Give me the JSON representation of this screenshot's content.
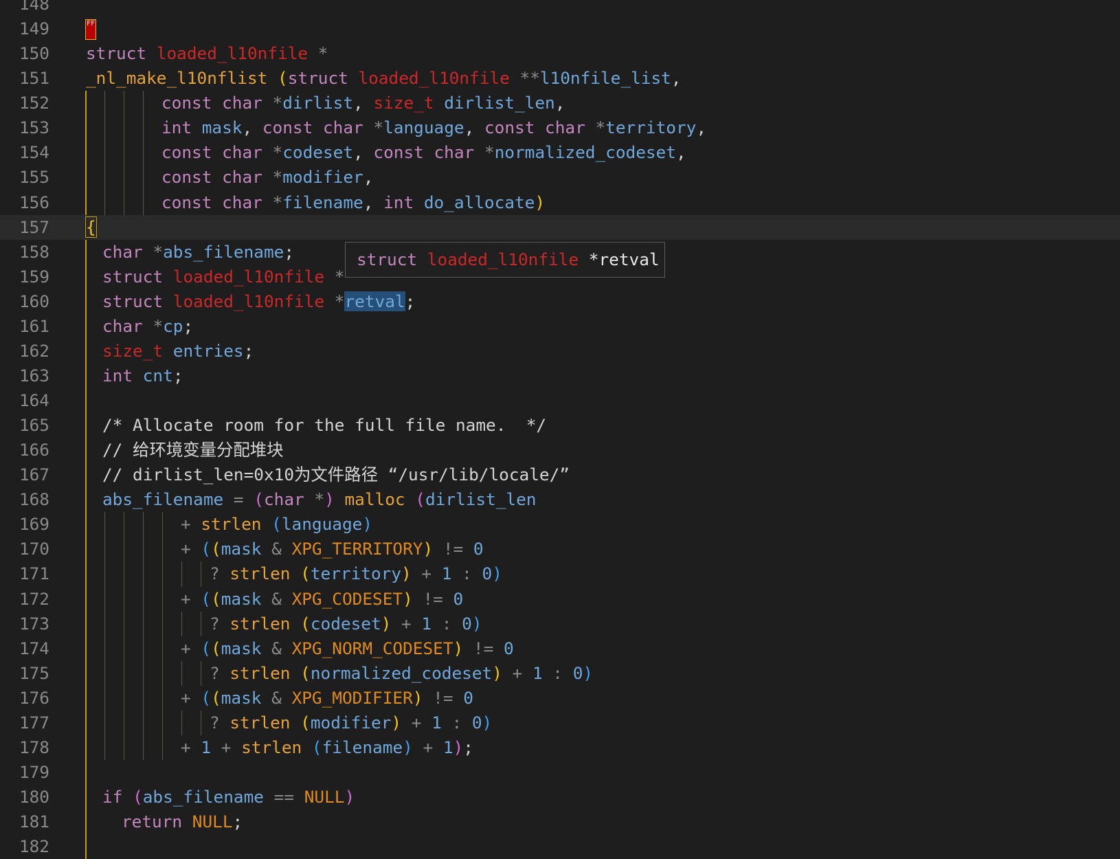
{
  "hover": {
    "kw": "struct",
    "type": "loaded_l10nfile",
    "rest": "*retval"
  },
  "lines": [
    {
      "n": "148",
      "tokens": []
    },
    {
      "n": "149",
      "tokens": [],
      "ff": "FF"
    },
    {
      "n": "150",
      "tokens": [
        {
          "t": "struct ",
          "c": "kw"
        },
        {
          "t": "loaded_l10nfile",
          "c": "ty"
        },
        {
          "t": " *",
          "c": "op"
        }
      ]
    },
    {
      "n": "151",
      "tokens": [
        {
          "t": "_nl_make_l10nflist",
          "c": "fn"
        },
        {
          "t": " ",
          "c": "pn"
        },
        {
          "t": "(",
          "c": "b1"
        },
        {
          "t": "struct ",
          "c": "kw"
        },
        {
          "t": "loaded_l10nfile",
          "c": "ty"
        },
        {
          "t": " **",
          "c": "op"
        },
        {
          "t": "l10nfile_list",
          "c": "va"
        },
        {
          "t": ",",
          "c": "pn"
        }
      ]
    },
    {
      "n": "152",
      "indent": 115,
      "tokens": [
        {
          "t": "const char ",
          "c": "kw"
        },
        {
          "t": "*",
          "c": "op"
        },
        {
          "t": "dirlist",
          "c": "va"
        },
        {
          "t": ", ",
          "c": "pn"
        },
        {
          "t": "size_t",
          "c": "ty"
        },
        {
          "t": " ",
          "c": "pn"
        },
        {
          "t": "dirlist_len",
          "c": "va"
        },
        {
          "t": ",",
          "c": "pn"
        }
      ]
    },
    {
      "n": "153",
      "indent": 115,
      "tokens": [
        {
          "t": "int ",
          "c": "kw"
        },
        {
          "t": "mask",
          "c": "va"
        },
        {
          "t": ", ",
          "c": "pn"
        },
        {
          "t": "const char ",
          "c": "kw"
        },
        {
          "t": "*",
          "c": "op"
        },
        {
          "t": "language",
          "c": "va"
        },
        {
          "t": ", ",
          "c": "pn"
        },
        {
          "t": "const char ",
          "c": "kw"
        },
        {
          "t": "*",
          "c": "op"
        },
        {
          "t": "territory",
          "c": "va"
        },
        {
          "t": ",",
          "c": "pn"
        }
      ]
    },
    {
      "n": "154",
      "indent": 115,
      "tokens": [
        {
          "t": "const char ",
          "c": "kw"
        },
        {
          "t": "*",
          "c": "op"
        },
        {
          "t": "codeset",
          "c": "va"
        },
        {
          "t": ", ",
          "c": "pn"
        },
        {
          "t": "const char ",
          "c": "kw"
        },
        {
          "t": "*",
          "c": "op"
        },
        {
          "t": "normalized_codeset",
          "c": "va"
        },
        {
          "t": ",",
          "c": "pn"
        }
      ]
    },
    {
      "n": "155",
      "indent": 115,
      "tokens": [
        {
          "t": "const char ",
          "c": "kw"
        },
        {
          "t": "*",
          "c": "op"
        },
        {
          "t": "modifier",
          "c": "va"
        },
        {
          "t": ",",
          "c": "pn"
        }
      ]
    },
    {
      "n": "156",
      "indent": 115,
      "tokens": [
        {
          "t": "const char ",
          "c": "kw"
        },
        {
          "t": "*",
          "c": "op"
        },
        {
          "t": "filename",
          "c": "va"
        },
        {
          "t": ", ",
          "c": "pn"
        },
        {
          "t": "int ",
          "c": "kw"
        },
        {
          "t": "do_allocate",
          "c": "va"
        },
        {
          "t": ")",
          "c": "b1"
        }
      ]
    },
    {
      "n": "157",
      "current": true,
      "tokens": [
        {
          "t": "{",
          "c": "b1 brace-hl"
        }
      ]
    },
    {
      "n": "158",
      "indent": 29,
      "tokens": [
        {
          "t": "char ",
          "c": "kw"
        },
        {
          "t": "*",
          "c": "op"
        },
        {
          "t": "abs_filename",
          "c": "va"
        },
        {
          "t": ";",
          "c": "pn"
        }
      ]
    },
    {
      "n": "159",
      "indent": 29,
      "tokens": [
        {
          "t": "struct ",
          "c": "kw"
        },
        {
          "t": "loaded_l10nfile",
          "c": "ty"
        },
        {
          "t": " *",
          "c": "op"
        }
      ]
    },
    {
      "n": "160",
      "indent": 29,
      "tokens": [
        {
          "t": "struct ",
          "c": "kw"
        },
        {
          "t": "loaded_l10nfile",
          "c": "ty"
        },
        {
          "t": " *",
          "c": "op"
        },
        {
          "t": "retval",
          "c": "va sel"
        },
        {
          "t": ";",
          "c": "pn"
        }
      ]
    },
    {
      "n": "161",
      "indent": 29,
      "tokens": [
        {
          "t": "char ",
          "c": "kw"
        },
        {
          "t": "*",
          "c": "op"
        },
        {
          "t": "cp",
          "c": "va"
        },
        {
          "t": ";",
          "c": "pn"
        }
      ]
    },
    {
      "n": "162",
      "indent": 29,
      "tokens": [
        {
          "t": "size_t",
          "c": "ty"
        },
        {
          "t": " ",
          "c": "pn"
        },
        {
          "t": "entries",
          "c": "va"
        },
        {
          "t": ";",
          "c": "pn"
        }
      ]
    },
    {
      "n": "163",
      "indent": 29,
      "tokens": [
        {
          "t": "int ",
          "c": "kw"
        },
        {
          "t": "cnt",
          "c": "va"
        },
        {
          "t": ";",
          "c": "pn"
        }
      ]
    },
    {
      "n": "164",
      "tokens": []
    },
    {
      "n": "165",
      "indent": 29,
      "tokens": [
        {
          "t": "/* Allocate room for the full file name.  */",
          "c": "cm"
        }
      ]
    },
    {
      "n": "166",
      "indent": 29,
      "tokens": [
        {
          "t": "// 给环境变量分配堆块",
          "c": "cm"
        }
      ]
    },
    {
      "n": "167",
      "indent": 29,
      "tokens": [
        {
          "t": "// dirlist_len=0x10为文件路径 “/usr/lib/locale/”",
          "c": "cm"
        }
      ]
    },
    {
      "n": "168",
      "indent": 29,
      "tokens": [
        {
          "t": "abs_filename",
          "c": "va"
        },
        {
          "t": " = ",
          "c": "op"
        },
        {
          "t": "(",
          "c": "b2"
        },
        {
          "t": "char ",
          "c": "kw"
        },
        {
          "t": "*",
          "c": "op"
        },
        {
          "t": ")",
          "c": "b2"
        },
        {
          "t": " ",
          "c": "pn"
        },
        {
          "t": "malloc",
          "c": "fn"
        },
        {
          "t": " ",
          "c": "pn"
        },
        {
          "t": "(",
          "c": "b2"
        },
        {
          "t": "dirlist_len",
          "c": "va"
        }
      ]
    },
    {
      "n": "169",
      "indent": 143,
      "tokens": [
        {
          "t": "+ ",
          "c": "op"
        },
        {
          "t": "strlen",
          "c": "fn"
        },
        {
          "t": " ",
          "c": "pn"
        },
        {
          "t": "(",
          "c": "b3"
        },
        {
          "t": "language",
          "c": "va"
        },
        {
          "t": ")",
          "c": "b3"
        }
      ]
    },
    {
      "n": "170",
      "indent": 143,
      "tokens": [
        {
          "t": "+ ",
          "c": "op"
        },
        {
          "t": "(",
          "c": "b3"
        },
        {
          "t": "(",
          "c": "b1"
        },
        {
          "t": "mask",
          "c": "va"
        },
        {
          "t": " & ",
          "c": "op"
        },
        {
          "t": "XPG_TERRITORY",
          "c": "mc"
        },
        {
          "t": ")",
          "c": "b1"
        },
        {
          "t": " != ",
          "c": "op"
        },
        {
          "t": "0",
          "c": "nu"
        }
      ]
    },
    {
      "n": "171",
      "indent": 185,
      "tokens": [
        {
          "t": "? ",
          "c": "op"
        },
        {
          "t": "strlen",
          "c": "fn"
        },
        {
          "t": " ",
          "c": "pn"
        },
        {
          "t": "(",
          "c": "b1"
        },
        {
          "t": "territory",
          "c": "va"
        },
        {
          "t": ")",
          "c": "b1"
        },
        {
          "t": " + ",
          "c": "op"
        },
        {
          "t": "1",
          "c": "nu"
        },
        {
          "t": " : ",
          "c": "op"
        },
        {
          "t": "0",
          "c": "nu"
        },
        {
          "t": ")",
          "c": "b3"
        }
      ]
    },
    {
      "n": "172",
      "indent": 143,
      "tokens": [
        {
          "t": "+ ",
          "c": "op"
        },
        {
          "t": "(",
          "c": "b3"
        },
        {
          "t": "(",
          "c": "b1"
        },
        {
          "t": "mask",
          "c": "va"
        },
        {
          "t": " & ",
          "c": "op"
        },
        {
          "t": "XPG_CODESET",
          "c": "mc"
        },
        {
          "t": ")",
          "c": "b1"
        },
        {
          "t": " != ",
          "c": "op"
        },
        {
          "t": "0",
          "c": "nu"
        }
      ]
    },
    {
      "n": "173",
      "indent": 185,
      "tokens": [
        {
          "t": "? ",
          "c": "op"
        },
        {
          "t": "strlen",
          "c": "fn"
        },
        {
          "t": " ",
          "c": "pn"
        },
        {
          "t": "(",
          "c": "b1"
        },
        {
          "t": "codeset",
          "c": "va"
        },
        {
          "t": ")",
          "c": "b1"
        },
        {
          "t": " + ",
          "c": "op"
        },
        {
          "t": "1",
          "c": "nu"
        },
        {
          "t": " : ",
          "c": "op"
        },
        {
          "t": "0",
          "c": "nu"
        },
        {
          "t": ")",
          "c": "b3"
        }
      ]
    },
    {
      "n": "174",
      "indent": 143,
      "tokens": [
        {
          "t": "+ ",
          "c": "op"
        },
        {
          "t": "(",
          "c": "b3"
        },
        {
          "t": "(",
          "c": "b1"
        },
        {
          "t": "mask",
          "c": "va"
        },
        {
          "t": " & ",
          "c": "op"
        },
        {
          "t": "XPG_NORM_CODESET",
          "c": "mc"
        },
        {
          "t": ")",
          "c": "b1"
        },
        {
          "t": " != ",
          "c": "op"
        },
        {
          "t": "0",
          "c": "nu"
        }
      ]
    },
    {
      "n": "175",
      "indent": 185,
      "tokens": [
        {
          "t": "? ",
          "c": "op"
        },
        {
          "t": "strlen",
          "c": "fn"
        },
        {
          "t": " ",
          "c": "pn"
        },
        {
          "t": "(",
          "c": "b1"
        },
        {
          "t": "normalized_codeset",
          "c": "va"
        },
        {
          "t": ")",
          "c": "b1"
        },
        {
          "t": " + ",
          "c": "op"
        },
        {
          "t": "1",
          "c": "nu"
        },
        {
          "t": " : ",
          "c": "op"
        },
        {
          "t": "0",
          "c": "nu"
        },
        {
          "t": ")",
          "c": "b3"
        }
      ]
    },
    {
      "n": "176",
      "indent": 143,
      "tokens": [
        {
          "t": "+ ",
          "c": "op"
        },
        {
          "t": "(",
          "c": "b3"
        },
        {
          "t": "(",
          "c": "b1"
        },
        {
          "t": "mask",
          "c": "va"
        },
        {
          "t": " & ",
          "c": "op"
        },
        {
          "t": "XPG_MODIFIER",
          "c": "mc"
        },
        {
          "t": ")",
          "c": "b1"
        },
        {
          "t": " != ",
          "c": "op"
        },
        {
          "t": "0",
          "c": "nu"
        }
      ]
    },
    {
      "n": "177",
      "indent": 185,
      "tokens": [
        {
          "t": "? ",
          "c": "op"
        },
        {
          "t": "strlen",
          "c": "fn"
        },
        {
          "t": " ",
          "c": "pn"
        },
        {
          "t": "(",
          "c": "b1"
        },
        {
          "t": "modifier",
          "c": "va"
        },
        {
          "t": ")",
          "c": "b1"
        },
        {
          "t": " + ",
          "c": "op"
        },
        {
          "t": "1",
          "c": "nu"
        },
        {
          "t": " : ",
          "c": "op"
        },
        {
          "t": "0",
          "c": "nu"
        },
        {
          "t": ")",
          "c": "b3"
        }
      ]
    },
    {
      "n": "178",
      "indent": 143,
      "tokens": [
        {
          "t": "+ ",
          "c": "op"
        },
        {
          "t": "1",
          "c": "nu"
        },
        {
          "t": " + ",
          "c": "op"
        },
        {
          "t": "strlen",
          "c": "fn"
        },
        {
          "t": " ",
          "c": "pn"
        },
        {
          "t": "(",
          "c": "b3"
        },
        {
          "t": "filename",
          "c": "va"
        },
        {
          "t": ")",
          "c": "b3"
        },
        {
          "t": " + ",
          "c": "op"
        },
        {
          "t": "1",
          "c": "nu"
        },
        {
          "t": ")",
          "c": "b2"
        },
        {
          "t": ";",
          "c": "pn"
        }
      ]
    },
    {
      "n": "179",
      "tokens": []
    },
    {
      "n": "180",
      "indent": 29,
      "tokens": [
        {
          "t": "if ",
          "c": "kw"
        },
        {
          "t": "(",
          "c": "b2"
        },
        {
          "t": "abs_filename",
          "c": "va"
        },
        {
          "t": " == ",
          "c": "op"
        },
        {
          "t": "NULL",
          "c": "mc"
        },
        {
          "t": ")",
          "c": "b2"
        }
      ]
    },
    {
      "n": "181",
      "indent": 57,
      "tokens": [
        {
          "t": "return ",
          "c": "kw"
        },
        {
          "t": "NULL",
          "c": "mc"
        },
        {
          "t": ";",
          "c": "pn"
        }
      ]
    },
    {
      "n": "182",
      "tokens": []
    }
  ]
}
